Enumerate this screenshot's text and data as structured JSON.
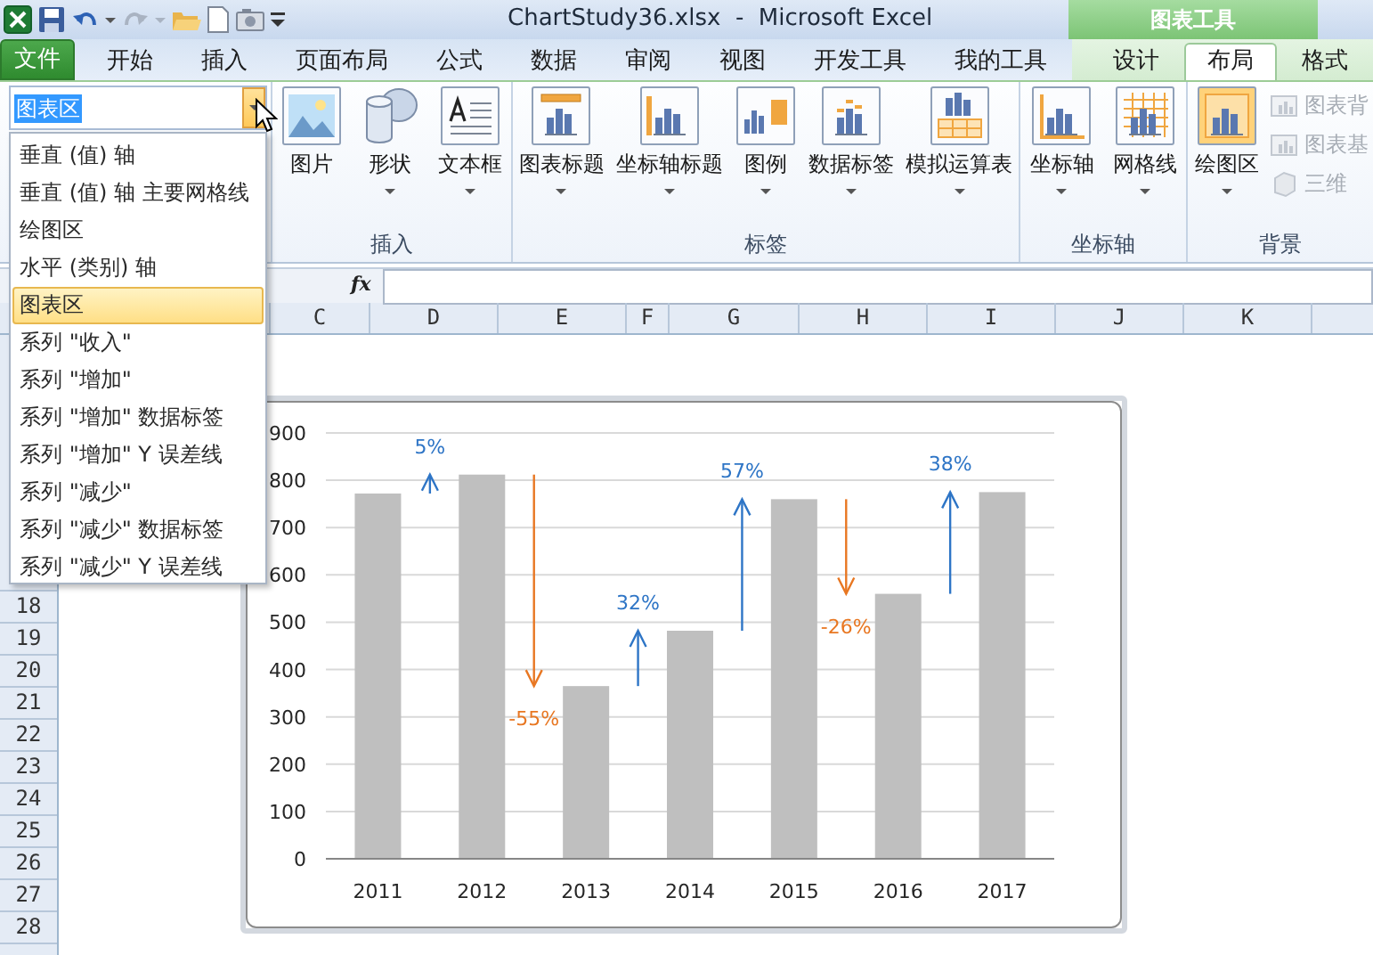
{
  "title_bar": {
    "title": "ChartStudy36.xlsx  -  Microsoft Excel",
    "context_group": "图表工具"
  },
  "ribbon_tabs": [
    {
      "label": "文件",
      "kind": "file",
      "selected": false
    },
    {
      "label": "开始",
      "kind": "tab",
      "selected": false
    },
    {
      "label": "插入",
      "kind": "tab",
      "selected": false
    },
    {
      "label": "页面布局",
      "kind": "tab",
      "selected": false
    },
    {
      "label": "公式",
      "kind": "tab",
      "selected": false
    },
    {
      "label": "数据",
      "kind": "tab",
      "selected": false
    },
    {
      "label": "审阅",
      "kind": "tab",
      "selected": false
    },
    {
      "label": "视图",
      "kind": "tab",
      "selected": false
    },
    {
      "label": "开发工具",
      "kind": "tab",
      "selected": false
    },
    {
      "label": "我的工具",
      "kind": "tab",
      "selected": false
    },
    {
      "label": "设计",
      "kind": "context",
      "selected": false
    },
    {
      "label": "布局",
      "kind": "context",
      "selected": true
    },
    {
      "label": "格式",
      "kind": "context",
      "selected": false
    }
  ],
  "element_selector": {
    "value": "图表区",
    "options": [
      {
        "label": "垂直 (值) 轴",
        "selected": false
      },
      {
        "label": "垂直 (值) 轴 主要网格线",
        "selected": false
      },
      {
        "label": "绘图区",
        "selected": false
      },
      {
        "label": "水平 (类别) 轴",
        "selected": false
      },
      {
        "label": "图表区",
        "selected": true
      },
      {
        "label": "系列 \"收入\"",
        "selected": false
      },
      {
        "label": "系列 \"增加\"",
        "selected": false
      },
      {
        "label": "系列 \"增加\" 数据标签",
        "selected": false
      },
      {
        "label": "系列 \"增加\" Y 误差线",
        "selected": false
      },
      {
        "label": "系列 \"减少\"",
        "selected": false
      },
      {
        "label": "系列 \"减少\" 数据标签",
        "selected": false
      },
      {
        "label": "系列 \"减少\" Y 误差线",
        "selected": false
      }
    ]
  },
  "ribbon_groups": [
    {
      "label": "插入",
      "buttons": [
        {
          "label": "图片",
          "dropdown": false
        },
        {
          "label": "形状",
          "dropdown": true
        },
        {
          "label": "文本框",
          "dropdown": true
        }
      ]
    },
    {
      "label": "标签",
      "buttons": [
        {
          "label": "图表标题",
          "dropdown": true
        },
        {
          "label": "坐标轴标题",
          "dropdown": true
        },
        {
          "label": "图例",
          "dropdown": true
        },
        {
          "label": "数据标签",
          "dropdown": true
        },
        {
          "label": "模拟运算表",
          "dropdown": true
        }
      ]
    },
    {
      "label": "坐标轴",
      "buttons": [
        {
          "label": "坐标轴",
          "dropdown": true
        },
        {
          "label": "网格线",
          "dropdown": true
        }
      ]
    },
    {
      "label": "背景",
      "buttons": [
        {
          "label": "绘图区",
          "dropdown": true
        }
      ],
      "small_buttons": [
        {
          "label": "图表背",
          "disabled": true
        },
        {
          "label": "图表基",
          "disabled": true
        },
        {
          "label": "三维",
          "disabled": true
        }
      ]
    }
  ],
  "formula_bar": {
    "function_label": "fx"
  },
  "sheet": {
    "columns": [
      "C",
      "D",
      "E",
      "F",
      "G",
      "H",
      "I",
      "J",
      "K"
    ],
    "rows": [
      "18",
      "19",
      "20",
      "21",
      "22",
      "23",
      "24",
      "25",
      "26",
      "27",
      "28"
    ]
  },
  "chart": {
    "chart_data": {
      "type": "bar",
      "categories": [
        "2011",
        "2012",
        "2013",
        "2014",
        "2015",
        "2016",
        "2017"
      ],
      "series": [
        {
          "color": "#bfbfbf",
          "values": [
            772,
            812,
            365,
            482,
            760,
            560,
            775
          ]
        }
      ],
      "ylim": [
        0,
        900
      ],
      "yticks": [
        0,
        100,
        200,
        300,
        400,
        500,
        600,
        700,
        800,
        900
      ],
      "grid": true
    },
    "change_arrows": [
      {
        "text": "5%",
        "kind": "increase",
        "color": "#2e75c6"
      },
      {
        "text": "-55%",
        "kind": "decrease",
        "color": "#e87722"
      },
      {
        "text": "32%",
        "kind": "increase",
        "color": "#2e75c6"
      },
      {
        "text": "57%",
        "kind": "increase",
        "color": "#2e75c6"
      },
      {
        "text": "-26%",
        "kind": "decrease",
        "color": "#e87722"
      },
      {
        "text": "38%",
        "kind": "increase",
        "color": "#2e75c6"
      }
    ]
  }
}
